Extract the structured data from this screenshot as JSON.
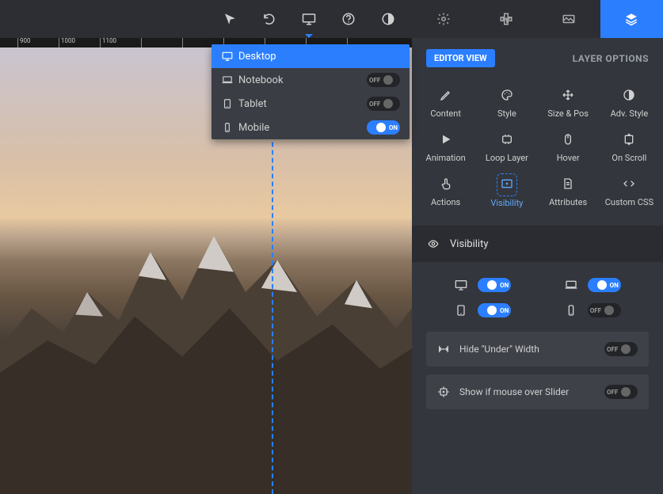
{
  "ruler": {
    "ticks": [
      "900",
      "1000",
      "1100"
    ]
  },
  "toolbar_icons": [
    "cursor",
    "undo",
    "desktop",
    "help",
    "contrast"
  ],
  "dropdown": {
    "items": [
      {
        "icon": "desktop",
        "label": "Desktop",
        "selected": true
      },
      {
        "icon": "notebook",
        "label": "Notebook",
        "toggle": "OFF"
      },
      {
        "icon": "tablet",
        "label": "Tablet",
        "toggle": "OFF"
      },
      {
        "icon": "mobile",
        "label": "Mobile",
        "toggle": "ON"
      }
    ]
  },
  "side_tabs": [
    "gear",
    "cross",
    "panorama",
    "layers"
  ],
  "side_tabs_active": 3,
  "editor_view_label": "EDITOR VIEW",
  "layer_options_label": "LAYER OPTIONS",
  "tools": [
    {
      "icon": "pencil",
      "label": "Content"
    },
    {
      "icon": "palette",
      "label": "Style"
    },
    {
      "icon": "move",
      "label": "Size & Pos"
    },
    {
      "icon": "contrast",
      "label": "Adv. Style"
    },
    {
      "icon": "play",
      "label": "Animation"
    },
    {
      "icon": "loop",
      "label": "Loop Layer"
    },
    {
      "icon": "mouse",
      "label": "Hover"
    },
    {
      "icon": "scroll",
      "label": "On Scroll"
    },
    {
      "icon": "touch",
      "label": "Actions"
    },
    {
      "icon": "eye-box",
      "label": "Visibility",
      "active": true
    },
    {
      "icon": "doc",
      "label": "Attributes"
    },
    {
      "icon": "code",
      "label": "Custom CSS"
    }
  ],
  "section_title": "Visibility",
  "visibility_toggles": [
    {
      "icon": "desktop",
      "state": "ON"
    },
    {
      "icon": "notebook",
      "state": "ON"
    },
    {
      "icon": "tablet",
      "state": "ON"
    },
    {
      "icon": "mobile",
      "state": "OFF"
    }
  ],
  "option_rows": [
    {
      "icon": "width",
      "label": "Hide \"Under\" Width",
      "state": "OFF"
    },
    {
      "icon": "target",
      "label": "Show if mouse over Slider",
      "state": "OFF"
    }
  ],
  "colors": {
    "accent": "#2b7fff"
  }
}
